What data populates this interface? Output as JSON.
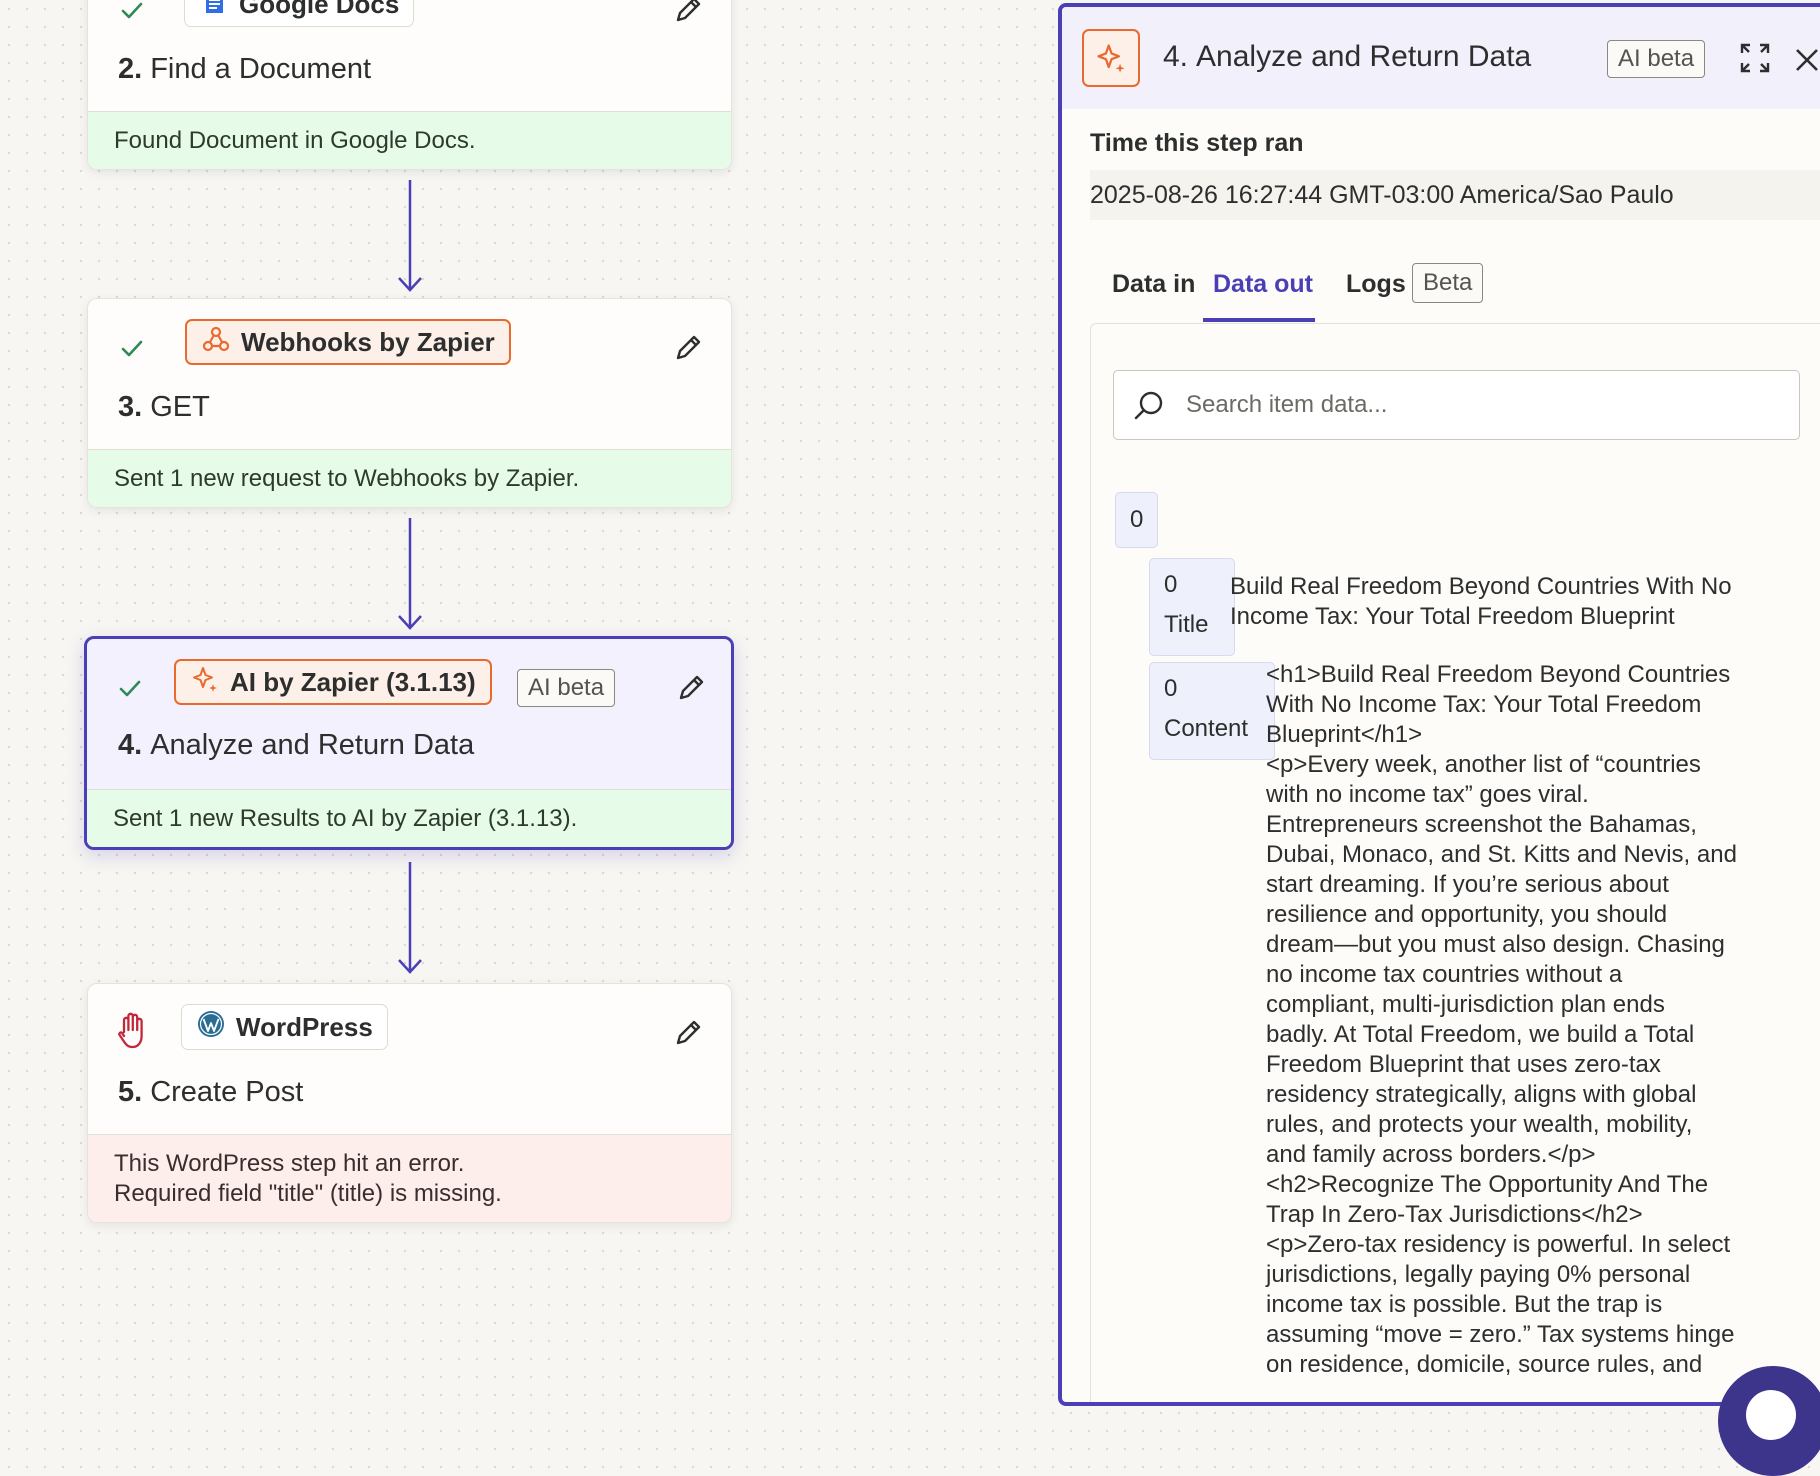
{
  "steps": [
    {
      "app_name": "Google Docs",
      "number": "2.",
      "title": "Find a Document",
      "status": "success",
      "footer": [
        "Found Document in Google Docs."
      ],
      "icon": "google-docs-icon"
    },
    {
      "app_name": "Webhooks by Zapier",
      "number": "3.",
      "title": "GET",
      "status": "success",
      "footer": [
        "Sent 1 new request to Webhooks by Zapier."
      ],
      "icon": "webhook-icon"
    },
    {
      "app_name": "AI by Zapier (3.1.13)",
      "badge": "AI beta",
      "number": "4.",
      "title": "Analyze and Return Data",
      "status": "success",
      "footer": [
        "Sent 1 new Results to AI by Zapier (3.1.13)."
      ],
      "icon": "ai-sparkle-icon"
    },
    {
      "app_name": "WordPress",
      "number": "5.",
      "title": "Create Post",
      "status": "error",
      "footer": [
        "This WordPress step hit an error.",
        "Required field \"title\" (title) is missing."
      ],
      "icon": "wordpress-icon"
    }
  ],
  "panel": {
    "number": "4.",
    "title": "Analyze and Return Data",
    "badge": "AI beta",
    "time_label": "Time this step ran",
    "time_value": "2025-08-26 16:27:44 GMT-03:00 America/Sao Paulo",
    "tabs": [
      {
        "label": "Data in",
        "selected": false
      },
      {
        "label": "Data out",
        "selected": true
      },
      {
        "label": "Logs",
        "selected": false,
        "badge": "Beta"
      }
    ],
    "search_placeholder": "Search item data...",
    "root_index": "0",
    "fields": [
      {
        "index": "0",
        "key": "Title",
        "value": "Build Real Freedom Beyond Countries With No\nIncome Tax: Your Total Freedom Blueprint"
      },
      {
        "index": "0",
        "key": "Content",
        "value": "<h1>Build Real Freedom Beyond Countries\nWith No Income Tax: Your Total Freedom\nBlueprint</h1>\n<p>Every week, another list of “countries\nwith no income tax” goes viral.\nEntrepreneurs screenshot the Bahamas,\nDubai, Monaco, and St. Kitts and Nevis, and\nstart dreaming. If you’re serious about\nresilience and opportunity, you should\ndream—but you must also design. Chasing\nno income tax countries without a\ncompliant, multi-jurisdiction plan ends\nbadly. At Total Freedom, we build a Total\nFreedom Blueprint that uses zero-tax\nresidency strategically, aligns with global\nrules, and protects your wealth, mobility,\nand family across borders.</p>\n<h2>Recognize The Opportunity And The\nTrap In Zero-Tax Jurisdictions</h2>\n<p>Zero-tax residency is powerful. In select\njurisdictions, legally paying 0% personal\nincome tax is possible. But the trap is\nassuming “move = zero.” Tax systems hinge\non residence, domicile, source rules, and"
      }
    ]
  },
  "colors": {
    "accent": "#4b3fb8",
    "success_bg": "#e6fbe8",
    "error_bg": "#fdeeec",
    "zapier_orange": "#e86a2f",
    "check_green": "#2e8b57",
    "error_red": "#c2283b"
  }
}
